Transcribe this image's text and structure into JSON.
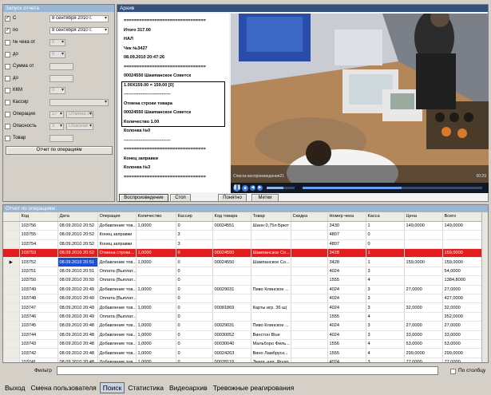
{
  "report_panel": {
    "title": "Запуск отчета",
    "filters": [
      {
        "label": "С",
        "checked": true,
        "value": "8 сентября 2010 г.",
        "kind": "dropdown",
        "enabled": true
      },
      {
        "label": "по",
        "checked": true,
        "value": "8 сентября 2010 г.",
        "kind": "dropdown",
        "enabled": true
      },
      {
        "label": "№ чека от",
        "checked": false,
        "value": "0",
        "kind": "spin",
        "enabled": false
      },
      {
        "label": "до",
        "checked": false,
        "value": "0",
        "kind": "spin",
        "enabled": false
      },
      {
        "label": "Сумма от",
        "checked": false,
        "value": "",
        "kind": "text",
        "enabled": false
      },
      {
        "label": "до",
        "checked": false,
        "value": "",
        "kind": "text",
        "enabled": false
      },
      {
        "label": "ККМ",
        "checked": false,
        "value": "0",
        "kind": "spin",
        "enabled": false
      },
      {
        "label": "Кассир",
        "checked": false,
        "value": "",
        "kind": "dropdown",
        "enabled": false
      },
      {
        "label": "Операция",
        "checked": false,
        "value": "27",
        "value2": "Отмена стро",
        "kind": "dual",
        "enabled": false
      },
      {
        "label": "Опасность",
        "checked": false,
        "value": "3",
        "value2": "Опасная",
        "kind": "dual",
        "enabled": false
      },
      {
        "label": "Товар",
        "checked": false,
        "value": "",
        "kind": "text",
        "enabled": false
      }
    ],
    "run_button": "Отчет по операциям"
  },
  "archive": {
    "title": "Архив",
    "receipt_lines": [
      "================================",
      "Итого 317.00",
      "НАЛ",
      "Чек №3427",
      "08.09.2010 20:47:26",
      "================================",
      "00024550 Шампанское Советск",
      "1.00X159.00 = 159.00 [0]",
      "--------------------------------",
      "Отмена строки товара",
      "00024550 Шампанское Советск",
      "Количество 1.00",
      "Колонка №0",
      "--------------------------------",
      "================================",
      "Конец заправки",
      "Колонка №3",
      "================================"
    ],
    "boxed_lines": [
      7,
      8,
      9,
      10,
      11
    ],
    "video": {
      "caption": "Список воспроизведения21",
      "timestamp": "00:29",
      "progress": 0.55
    },
    "buttons": {
      "play": "Воспроизведение",
      "stop": "Стоп",
      "understood": "Понятно",
      "marks": "Метки"
    }
  },
  "operations": {
    "title": "Отчет по операциям",
    "columns": [
      "",
      "Код",
      "Дата",
      "Операция",
      "Количество",
      "Кассир",
      "Код товара",
      "Товар",
      "Скидка",
      "Номер чека",
      "Касса",
      "Цена",
      "Всего"
    ],
    "rows": [
      [
        "",
        "103756",
        "08.09.2010 20:52",
        "Добавление тов...",
        "1,0000",
        "0",
        "00024551",
        "Шанн 0,75л Брют",
        "",
        "3430",
        "1",
        "149,0000",
        "149,0000"
      ],
      [
        "",
        "103755",
        "08.09.2010 20:52",
        "Конец заправки",
        "",
        "3",
        "",
        "",
        "",
        "4807",
        "0",
        "",
        ""
      ],
      [
        "",
        "103754",
        "08.09.2010 20:52",
        "Конец заправки",
        "",
        "3",
        "",
        "",
        "",
        "4807",
        "0",
        "",
        ""
      ],
      [
        "",
        "103753",
        "08.09.2010 20:52",
        "Отмена строки...",
        "1,0000",
        "0",
        "00024550",
        "Шампанское Со...",
        "",
        "3428",
        "1",
        "",
        "159,0000"
      ],
      [
        "▶",
        "103752",
        "08.09.2010 20:51",
        "Добавление тов...",
        "1,0000",
        "0",
        "00024550",
        "Шампанское Со...",
        "",
        "3428",
        "1",
        "159,0000",
        "159,0000"
      ],
      [
        "",
        "103751",
        "08.09.2010 20:51",
        "Оплата (Выплат...",
        "",
        "0",
        "",
        "",
        "",
        "4024",
        "3",
        "",
        "54,0000"
      ],
      [
        "",
        "103750",
        "08.09.2010 20:50",
        "Оплата (Выплат...",
        "",
        "0",
        "",
        "",
        "",
        "1555",
        "4",
        "",
        "1384,8000"
      ],
      [
        "",
        "103749",
        "08.09.2010 20:49",
        "Добавление тов...",
        "1,0000",
        "0",
        "00029031",
        "Пиво Клинское ...",
        "",
        "4024",
        "3",
        "27,0000",
        "27,0000"
      ],
      [
        "",
        "103748",
        "08.09.2010 20:49",
        "Оплата (Выплат...",
        "",
        "0",
        "",
        "",
        "",
        "4024",
        "3",
        "",
        "427,0000"
      ],
      [
        "",
        "103747",
        "08.09.2010 20:49",
        "Добавление тов...",
        "1,0000",
        "0",
        "00081869",
        "Карты игр. 36 ш(",
        "",
        "4024",
        "3",
        "32,0000",
        "32,0000"
      ],
      [
        "",
        "103746",
        "08.09.2010 20:49",
        "Оплата (Выплат...",
        "",
        "0",
        "",
        "",
        "",
        "1555",
        "4",
        "",
        "352,0000"
      ],
      [
        "",
        "103745",
        "08.09.2010 20:48",
        "Добавление тов...",
        "1,0000",
        "0",
        "00029031",
        "Пиво Клинское ...",
        "",
        "4024",
        "3",
        "27,0000",
        "27,0000"
      ],
      [
        "",
        "103744",
        "08.09.2010 20:48",
        "Добавление тов...",
        "1,0000",
        "0",
        "00030052",
        "Винстон Blue",
        "",
        "4024",
        "3",
        "33,0000",
        "33,0000"
      ],
      [
        "",
        "103743",
        "08.09.2010 20:48",
        "Добавление тов...",
        "1,0000",
        "0",
        "00030040",
        "Мальборо Филь...",
        "",
        "1556",
        "4",
        "53,0000",
        "53,0000"
      ],
      [
        "",
        "103742",
        "08.09.2010 20:48",
        "Добавление тов...",
        "1,0000",
        "0",
        "00024263",
        "Вино Ламбруск...",
        "",
        "1555",
        "4",
        "299,0000",
        "299,0000"
      ],
      [
        "",
        "103741",
        "08.09.2010 20:48",
        "Добавление тов...",
        "1,0000",
        "0",
        "00028119",
        "Энерг. нап. Ягуар",
        "",
        "4024",
        "3",
        "77,0000",
        "77,0000"
      ]
    ],
    "highlight_row": 3,
    "current_row": 4,
    "current_col": 2
  },
  "filter": {
    "label": "Фильтр",
    "value": "",
    "by_column_label": "По столбцу",
    "by_column_checked": false
  },
  "tabs": [
    {
      "label": "Выход",
      "selected": false
    },
    {
      "label": "Смена пользователя",
      "selected": false
    },
    {
      "label": "Поиск",
      "selected": true
    },
    {
      "label": "Статистика",
      "selected": false
    },
    {
      "label": "Видеоархив",
      "selected": false
    },
    {
      "label": "Тревожные реагирования",
      "selected": false
    }
  ],
  "colors": {
    "highlight_red": "#e11d1d",
    "selection_blue": "#1c4fd1",
    "panel_header": "#9bb6d3"
  }
}
